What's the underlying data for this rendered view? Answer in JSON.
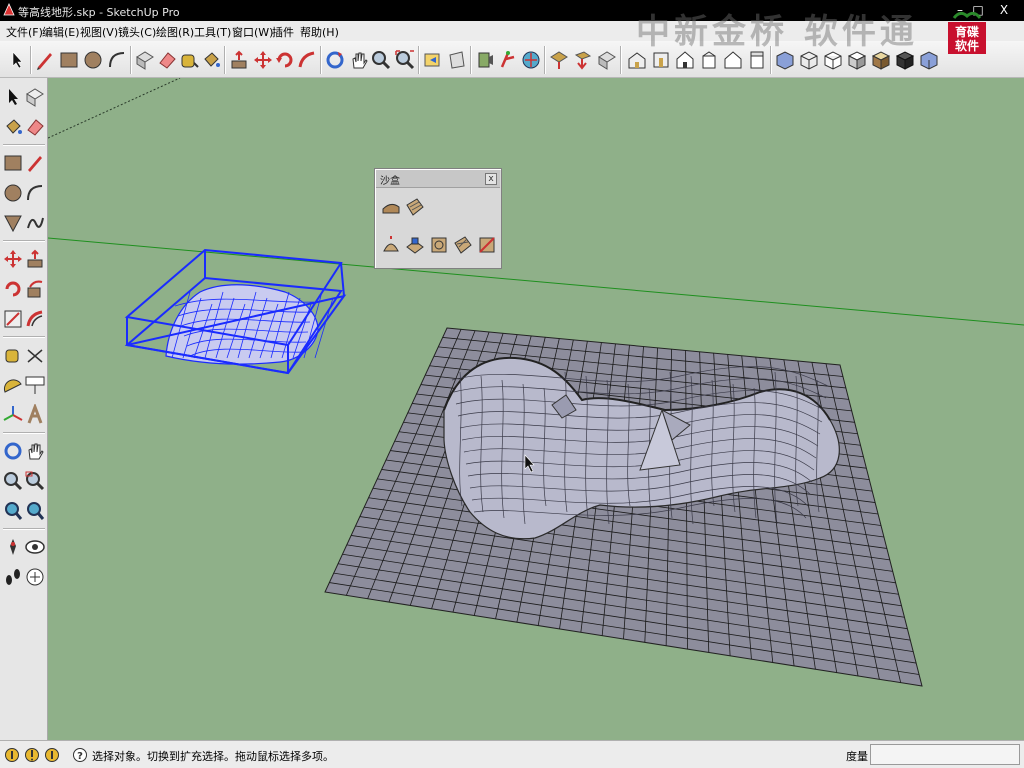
{
  "window": {
    "title": "等高线地形.skp - SketchUp Pro",
    "minimize": "–",
    "maximize": "□",
    "close": "X"
  },
  "menu": [
    {
      "label": "文件(F)"
    },
    {
      "label": "编辑(E)"
    },
    {
      "label": "视图(V)"
    },
    {
      "label": "镜头(C)"
    },
    {
      "label": "绘图(R)"
    },
    {
      "label": "工具(T)"
    },
    {
      "label": "窗口(W)"
    },
    {
      "label": "插件"
    },
    {
      "label": "帮助(H)"
    }
  ],
  "watermark": "中新金桥 软件通",
  "logo": {
    "line1": "育碟",
    "line2": "软件"
  },
  "sandbox_toolbar": {
    "title": "沙盒",
    "close": "x"
  },
  "status": {
    "message": "选择对象。切换到扩充选择。拖动鼠标选择多项。",
    "measurements_label": "度量",
    "measurements_value": ""
  },
  "colors": {
    "viewport_bg": "#8fb089",
    "terrain_face": "#b7b8cb",
    "selection": "#1a2bff",
    "green_axis": "#1e8f1e"
  }
}
